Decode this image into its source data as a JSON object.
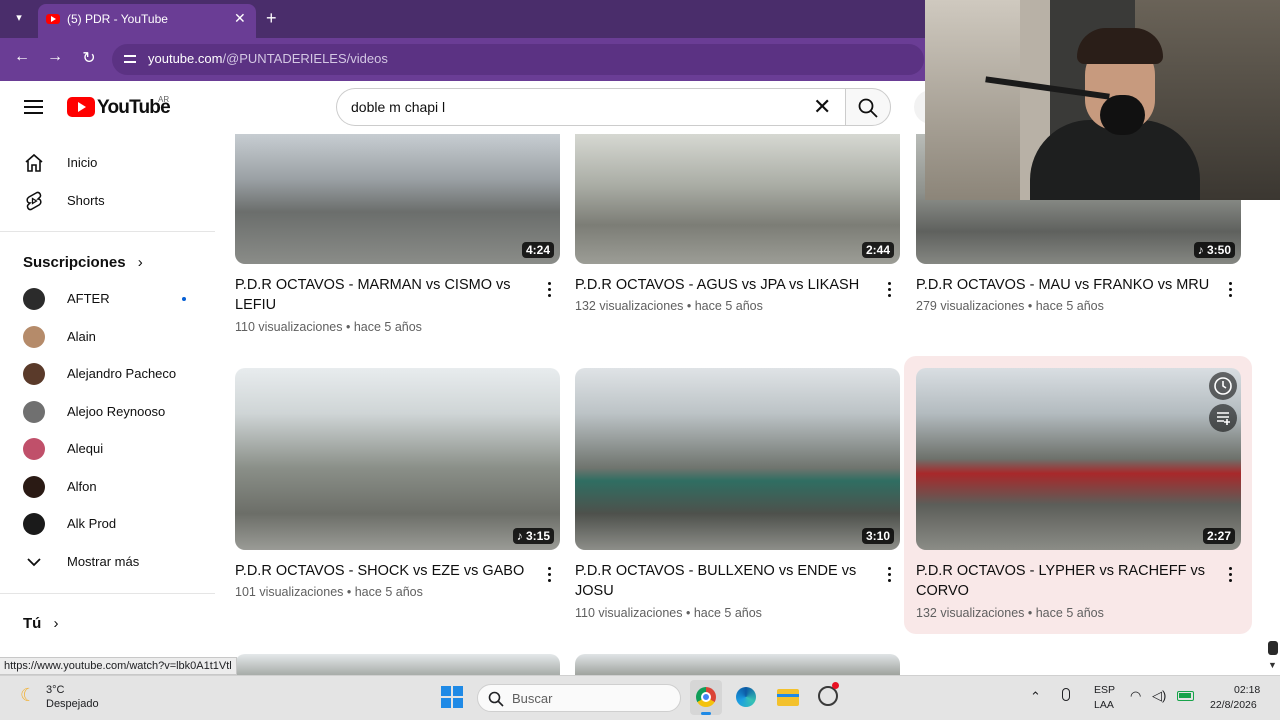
{
  "browser": {
    "tab_title": "(5) PDR - YouTube",
    "url_host": "youtube.com",
    "url_path": "/@PUNTADERIELES/videos",
    "status_url": "https://www.youtube.com/watch?v=lbk0A1t1Vtl"
  },
  "youtube": {
    "logo_text": "YouTube",
    "region": "AR",
    "search_value": "doble m chapi l"
  },
  "sidebar": {
    "home": "Inicio",
    "shorts": "Shorts",
    "subscriptions_title": "Suscripciones",
    "subscriptions": [
      {
        "name": "AFTER",
        "color": "#2b2b2b",
        "new": true
      },
      {
        "name": "Alain",
        "color": "#b58b6a",
        "new": false
      },
      {
        "name": "Alejandro Pacheco",
        "color": "#5a3a2a",
        "new": false
      },
      {
        "name": "Alejoo Reynooso",
        "color": "#707070",
        "new": false
      },
      {
        "name": "Alequi",
        "color": "#c0506a",
        "new": false
      },
      {
        "name": "Alfon",
        "color": "#2a1a14",
        "new": false
      },
      {
        "name": "Alk Prod",
        "color": "#1a1a1a",
        "new": false
      }
    ],
    "show_more": "Mostrar más",
    "you_title": "Tú"
  },
  "videos": [
    {
      "title": "P.D.R OCTAVOS - MARMAN vs CISMO vs LEFIU",
      "views": "110 visualizaciones",
      "age": "hace 5 años",
      "duration": "4:24",
      "short": false
    },
    {
      "title": "P.D.R OCTAVOS - AGUS vs JPA vs LIKASH",
      "views": "132 visualizaciones",
      "age": "hace 5 años",
      "duration": "2:44",
      "short": false
    },
    {
      "title": "P.D.R OCTAVOS - MAU vs FRANKO vs MRU",
      "views": "279 visualizaciones",
      "age": "hace 5 años",
      "duration": "3:50",
      "short": true
    },
    {
      "title": "P.D.R OCTAVOS - SHOCK vs EZE vs GABO",
      "views": "101 visualizaciones",
      "age": "hace 5 años",
      "duration": "3:15",
      "short": true
    },
    {
      "title": "P.D.R OCTAVOS - BULLXENO vs ENDE vs JOSU",
      "views": "110 visualizaciones",
      "age": "hace 5 años",
      "duration": "3:10",
      "short": false
    },
    {
      "title": "P.D.R OCTAVOS - LYPHER vs RACHEFF vs CORVO",
      "views": "132 visualizaciones",
      "age": "hace 5 años",
      "duration": "2:27",
      "short": false
    }
  ],
  "taskbar": {
    "temp": "3°C",
    "weather": "Despejado",
    "search_placeholder": "Buscar",
    "lang1": "ESP",
    "lang2": "LAA",
    "time": "02:18",
    "date": "22/8/2026"
  },
  "colors": {
    "browser_tabbar": "#4a2d6b",
    "browser_toolbar": "#6a3d95",
    "yt_red": "#ff0000",
    "hover_card": "#f9e8e8"
  }
}
